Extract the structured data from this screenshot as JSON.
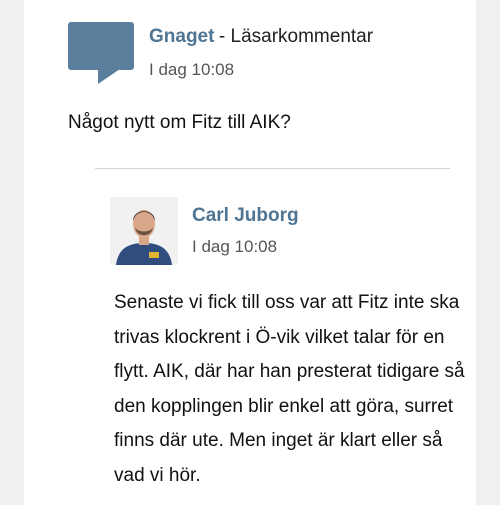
{
  "question": {
    "author": "Gnaget",
    "type_label": "- Läsarkommentar",
    "time": "I dag 10:08",
    "text": "Något nytt om Fitz till AIK?"
  },
  "answer": {
    "author": "Carl Juborg",
    "time": "I dag 10:08",
    "text": "Senaste vi fick till oss var att Fitz inte ska trivas klockrent i Ö-vik vilket talar för en flytt. AIK, där har han presterat tidigare så den kopplingen blir enkel att göra, surret finns där ute. Men inget är klart eller så vad vi hör."
  },
  "colors": {
    "accent": "#4f7594",
    "bubble": "#5a7e9c",
    "background": "#f1f1f3",
    "card": "#ffffff"
  },
  "icons": {
    "question_icon": "speech-bubble-icon"
  }
}
